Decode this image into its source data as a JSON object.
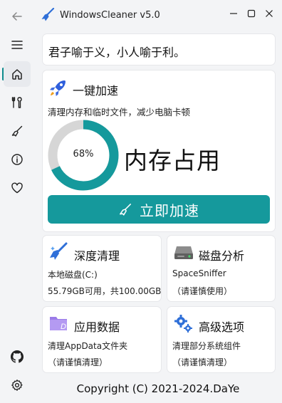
{
  "app": {
    "title": "WindowsCleaner v5.0"
  },
  "sidebar": {
    "items": [
      {
        "icon": "back-arrow-icon"
      },
      {
        "icon": "menu-icon"
      },
      {
        "icon": "home-icon"
      },
      {
        "icon": "tools-icon"
      },
      {
        "icon": "broom-icon"
      },
      {
        "icon": "info-icon"
      },
      {
        "icon": "heart-icon"
      },
      {
        "icon": "github-icon"
      },
      {
        "icon": "settings-icon"
      }
    ],
    "active_index": 2
  },
  "window_controls": {
    "minimize": "minimize-icon",
    "maximize": "maximize-icon",
    "close": "close-icon"
  },
  "quote": "君子喻于义，小人喻于利。",
  "speedup": {
    "title": "一键加速",
    "description": "清理内存和临时文件，减少电脑卡顿",
    "memory_percent": 68,
    "memory_percent_label": "68%",
    "memory_label": "内存占用",
    "button_label": "立即加速"
  },
  "cards": {
    "deep_clean": {
      "title": "深度清理",
      "line1": "本地磁盘(C:)",
      "line2": "55.79GB可用，共100.00GB"
    },
    "disk_analysis": {
      "title": "磁盘分析",
      "line1": "SpaceSniffer",
      "line2": "（请谨慎使用）"
    },
    "app_data": {
      "title": "应用数据",
      "line1": "清理AppData文件夹",
      "line2": "（请谨慎清理）"
    },
    "advanced": {
      "title": "高级选项",
      "line1": "清理部分系统组件",
      "line2": "（请谨慎清理）"
    }
  },
  "footer": {
    "copyright": "Copyright (C) 2021-2024.DaYe"
  },
  "colors": {
    "accent": "#15999c",
    "ring_track": "#d6d6d6",
    "background": "#f3f4f6"
  }
}
